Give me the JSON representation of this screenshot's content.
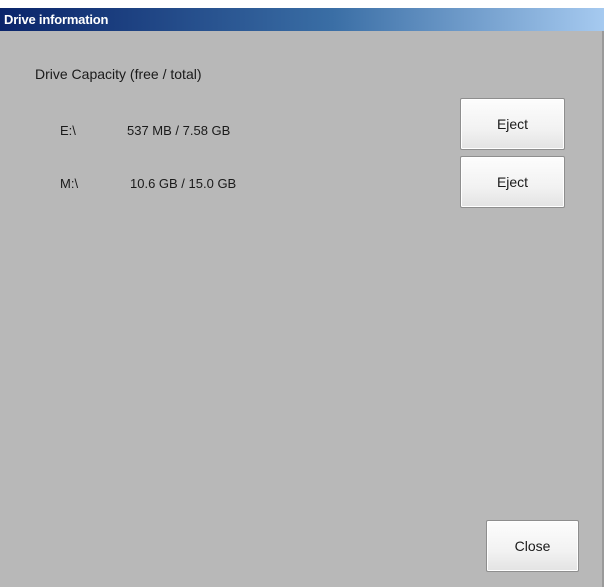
{
  "window": {
    "title": "Drive information"
  },
  "section": {
    "label": "Drive Capacity (free / total)"
  },
  "drives": [
    {
      "letter": "E:\\",
      "capacity": "537 MB / 7.58 GB",
      "eject_label": "Eject"
    },
    {
      "letter": "M:\\",
      "capacity": "10.6 GB / 15.0 GB",
      "eject_label": "Eject"
    }
  ],
  "footer": {
    "close_label": "Close"
  },
  "colors": {
    "panel_bg": "#b8b8b8",
    "titlebar_start": "#0a246a",
    "titlebar_end": "#a6caf0"
  }
}
